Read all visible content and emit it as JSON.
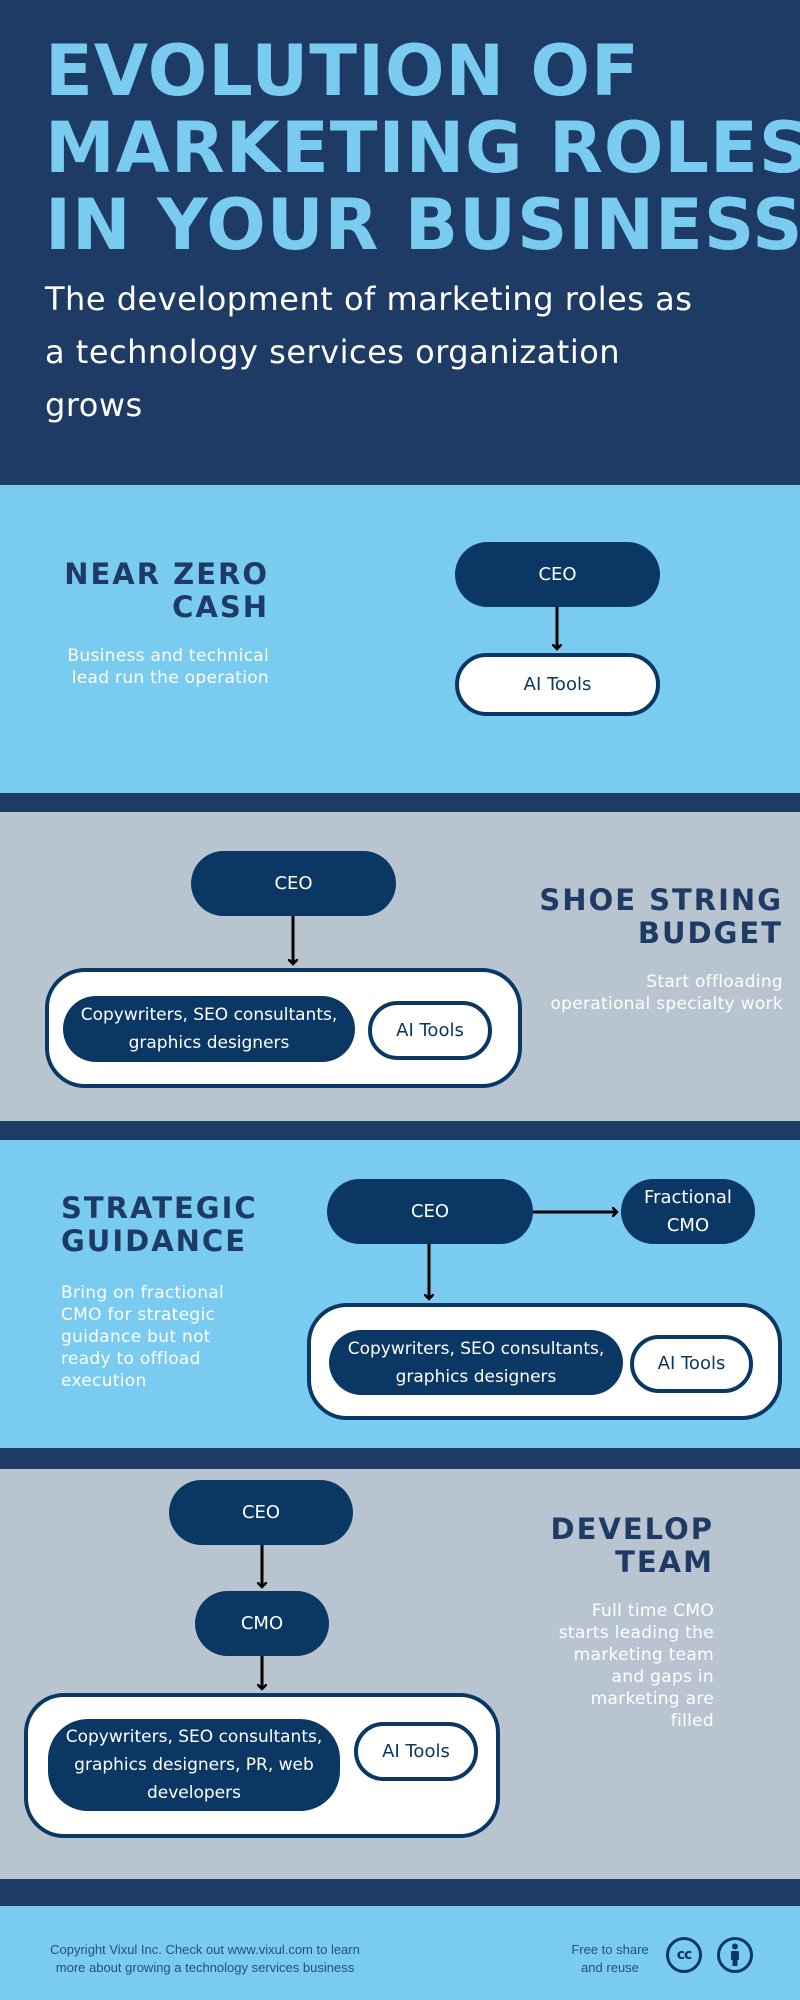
{
  "header": {
    "title_lines": [
      "EVOLUTION OF",
      "MARKETING ROLES",
      "IN YOUR BUSINESS"
    ],
    "subtitle_lines": [
      "The development of marketing roles as",
      "a technology services organization",
      "grows"
    ]
  },
  "colors": {
    "navy": "#1d3b64",
    "node_navy": "#0a3764",
    "light_blue": "#79cbf0",
    "gray": "#b9c4d1",
    "white": "#ffffff"
  },
  "stages": [
    {
      "heading_lines": [
        "NEAR ZERO",
        "CASH"
      ],
      "description_lines": [
        "Business and technical",
        "lead run the operation"
      ],
      "nodes": {
        "ceo": "CEO",
        "ai_tools": "AI Tools"
      }
    },
    {
      "heading_lines": [
        "SHOE STRING",
        "BUDGET"
      ],
      "description_lines": [
        "Start offloading",
        "operational specialty work"
      ],
      "nodes": {
        "ceo": "CEO",
        "specialists_lines": [
          "Copywriters, SEO consultants,",
          "graphics designers"
        ],
        "ai_tools": "AI Tools"
      }
    },
    {
      "heading_lines": [
        "STRATEGIC",
        "GUIDANCE"
      ],
      "description_lines": [
        "Bring on fractional",
        "CMO for strategic",
        "guidance but not",
        "ready to offload",
        "execution"
      ],
      "nodes": {
        "ceo": "CEO",
        "fractional_cmo_lines": [
          "Fractional",
          "CMO"
        ],
        "specialists_lines": [
          "Copywriters, SEO consultants,",
          "graphics designers"
        ],
        "ai_tools": "AI Tools"
      }
    },
    {
      "heading_lines": [
        "DEVELOP",
        "TEAM"
      ],
      "description_lines": [
        "Full time CMO",
        "starts leading the",
        "marketing team",
        "and gaps in",
        "marketing are",
        "filled"
      ],
      "nodes": {
        "ceo": "CEO",
        "cmo": "CMO",
        "specialists_lines": [
          "Copywriters, SEO consultants,",
          "graphics designers, PR, web",
          "developers"
        ],
        "ai_tools": "AI Tools"
      }
    }
  ],
  "footer": {
    "copyright_lines": [
      "Copyright Vixul Inc. Check out www.vixul.com to learn",
      "more about growing a technology services business"
    ],
    "license_lines": [
      "Free to share",
      "and reuse"
    ],
    "icons": [
      "creative-commons-icon",
      "attribution-icon"
    ],
    "cc_glyph": "cc"
  }
}
